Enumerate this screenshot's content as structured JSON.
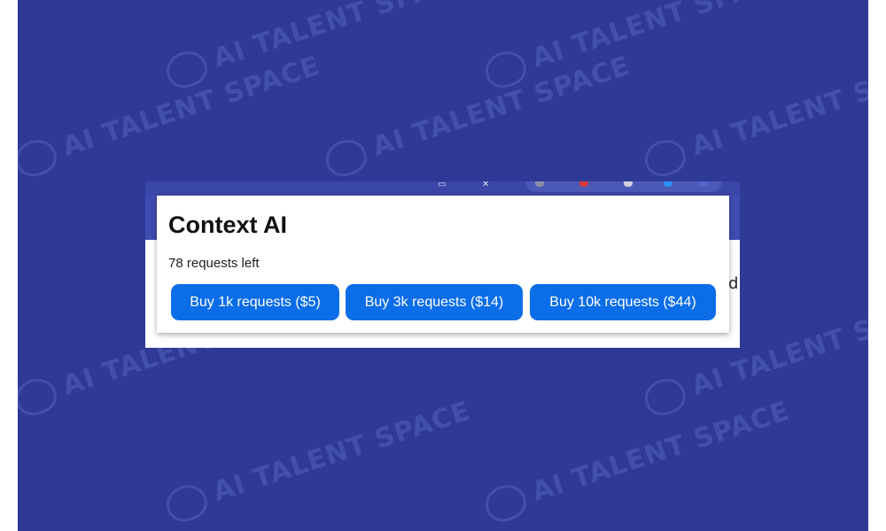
{
  "watermark": {
    "text": "AI TALENT SPACE"
  },
  "popup": {
    "title": "Context AI",
    "status": "78 requests left",
    "buttons": [
      {
        "label": "Buy 1k requests ($5)"
      },
      {
        "label": "Buy 3k requests ($14)"
      },
      {
        "label": "Buy 10k requests ($44)"
      }
    ]
  },
  "behind_page": {
    "fragment": "d"
  },
  "colors": {
    "background": "#2f3a97",
    "button": "#0b6de8",
    "button_text": "#ffffff",
    "title_text": "#111111"
  }
}
